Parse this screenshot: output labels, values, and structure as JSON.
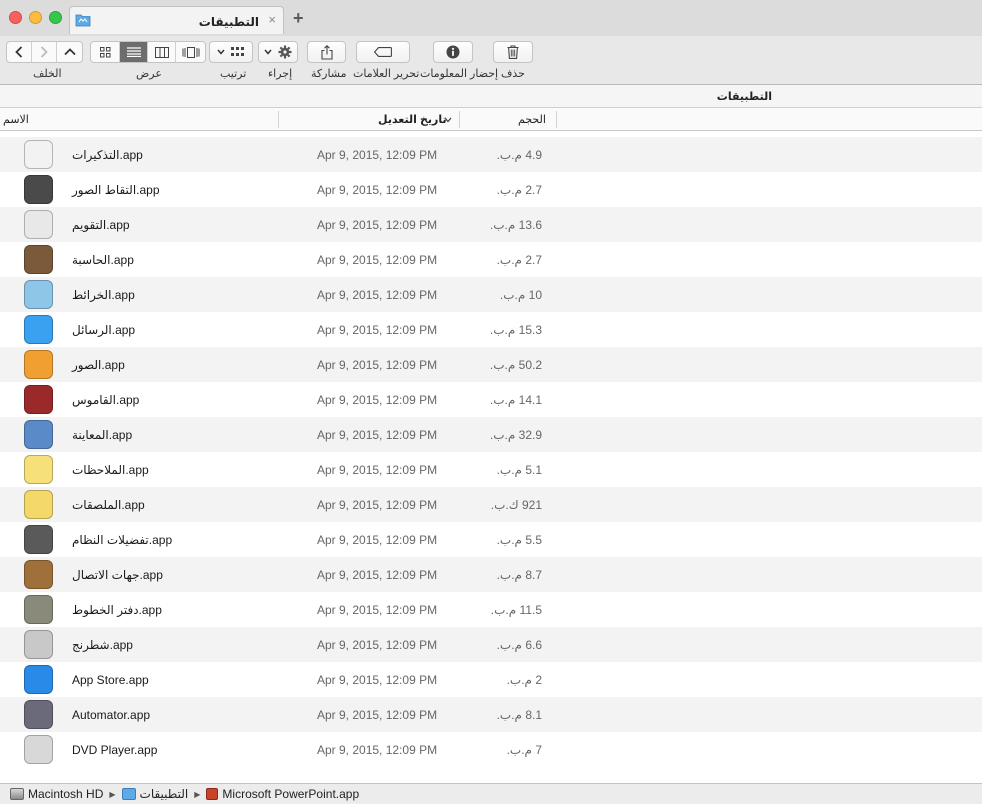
{
  "window": {
    "tab_title": "التطبيقات",
    "tab_close": "×",
    "tab_add": "+"
  },
  "toolbar": {
    "back_label": "الخلف",
    "view_label": "عرض",
    "arrange_label": "ترتيب",
    "action_label": "إجراء",
    "share_label": "مشاركة",
    "tags_label": "تحرير العلامات",
    "info_label": "إحضار المعلومات",
    "delete_label": "حذف"
  },
  "path_header": "التطبيقات",
  "columns": {
    "name": "الاسم",
    "date": "تاريخ التعديل",
    "size": "الحجم"
  },
  "rows": [
    {
      "name": "التذكيرات.app",
      "date": "Apr 9, 2015, 12:09 PM",
      "size": "4.9 م.ب.",
      "icon": "reminders-icon",
      "color": "#f2f2f2"
    },
    {
      "name": "التقاط الصور.app",
      "date": "Apr 9, 2015, 12:09 PM",
      "size": "2.7 م.ب.",
      "icon": "image-capture-icon",
      "color": "#4a4a4a"
    },
    {
      "name": "التقويم.app",
      "date": "Apr 9, 2015, 12:09 PM",
      "size": "13.6 م.ب.",
      "icon": "calendar-icon",
      "color": "#e8e8e8"
    },
    {
      "name": "الحاسبة.app",
      "date": "Apr 9, 2015, 12:09 PM",
      "size": "2.7 م.ب.",
      "icon": "calculator-icon",
      "color": "#7a5a3a"
    },
    {
      "name": "الخرائط.app",
      "date": "Apr 9, 2015, 12:09 PM",
      "size": "10 م.ب.",
      "icon": "maps-icon",
      "color": "#8ec6e8"
    },
    {
      "name": "الرسائل.app",
      "date": "Apr 9, 2015, 12:09 PM",
      "size": "15.3 م.ب.",
      "icon": "messages-icon",
      "color": "#3aa0f0"
    },
    {
      "name": "الصور.app",
      "date": "Apr 9, 2015, 12:09 PM",
      "size": "50.2 م.ب.",
      "icon": "photos-icon",
      "color": "#f0a030"
    },
    {
      "name": "القاموس.app",
      "date": "Apr 9, 2015, 12:09 PM",
      "size": "14.1 م.ب.",
      "icon": "dictionary-icon",
      "color": "#9a2a2a"
    },
    {
      "name": "المعاينة.app",
      "date": "Apr 9, 2015, 12:09 PM",
      "size": "32.9 م.ب.",
      "icon": "preview-icon",
      "color": "#5a8ac8"
    },
    {
      "name": "الملاحظات.app",
      "date": "Apr 9, 2015, 12:09 PM",
      "size": "5.1 م.ب.",
      "icon": "notes-icon",
      "color": "#f5e07a"
    },
    {
      "name": "الملصقات.app",
      "date": "Apr 9, 2015, 12:09 PM",
      "size": "921 ك.ب.",
      "icon": "stickies-icon",
      "color": "#f3d86a"
    },
    {
      "name": "تفضيلات النظام.app",
      "date": "Apr 9, 2015, 12:09 PM",
      "size": "5.5 م.ب.",
      "icon": "system-preferences-icon",
      "color": "#5a5a5a"
    },
    {
      "name": "جهات الاتصال.app",
      "date": "Apr 9, 2015, 12:09 PM",
      "size": "8.7 م.ب.",
      "icon": "contacts-icon",
      "color": "#a0703a"
    },
    {
      "name": "دفتر الخطوط.app",
      "date": "Apr 9, 2015, 12:09 PM",
      "size": "11.5 م.ب.",
      "icon": "font-book-icon",
      "color": "#8a8a7a"
    },
    {
      "name": "شطرنج.app",
      "date": "Apr 9, 2015, 12:09 PM",
      "size": "6.6 م.ب.",
      "icon": "chess-icon",
      "color": "#c8c8c8"
    },
    {
      "name": "App Store.app",
      "date": "Apr 9, 2015, 12:09 PM",
      "size": "2 م.ب.",
      "icon": "app-store-icon",
      "color": "#2a8ae8"
    },
    {
      "name": "Automator.app",
      "date": "Apr 9, 2015, 12:09 PM",
      "size": "8.1 م.ب.",
      "icon": "automator-icon",
      "color": "#6a6a7a"
    },
    {
      "name": "DVD Player.app",
      "date": "Apr 9, 2015, 12:09 PM",
      "size": "7 م.ب.",
      "icon": "dvd-player-icon",
      "color": "#d8d8d8"
    }
  ],
  "statusbar": {
    "crumbs": [
      "Macintosh HD",
      "التطبيقات",
      "Microsoft PowerPoint.app"
    ],
    "separator": "▶"
  },
  "colors": {
    "titlebar": "#dcdcdc",
    "row_alt": "#f3f3f3",
    "folder_blue": "#5ea9e6",
    "powerpoint_red": "#c8442a"
  }
}
